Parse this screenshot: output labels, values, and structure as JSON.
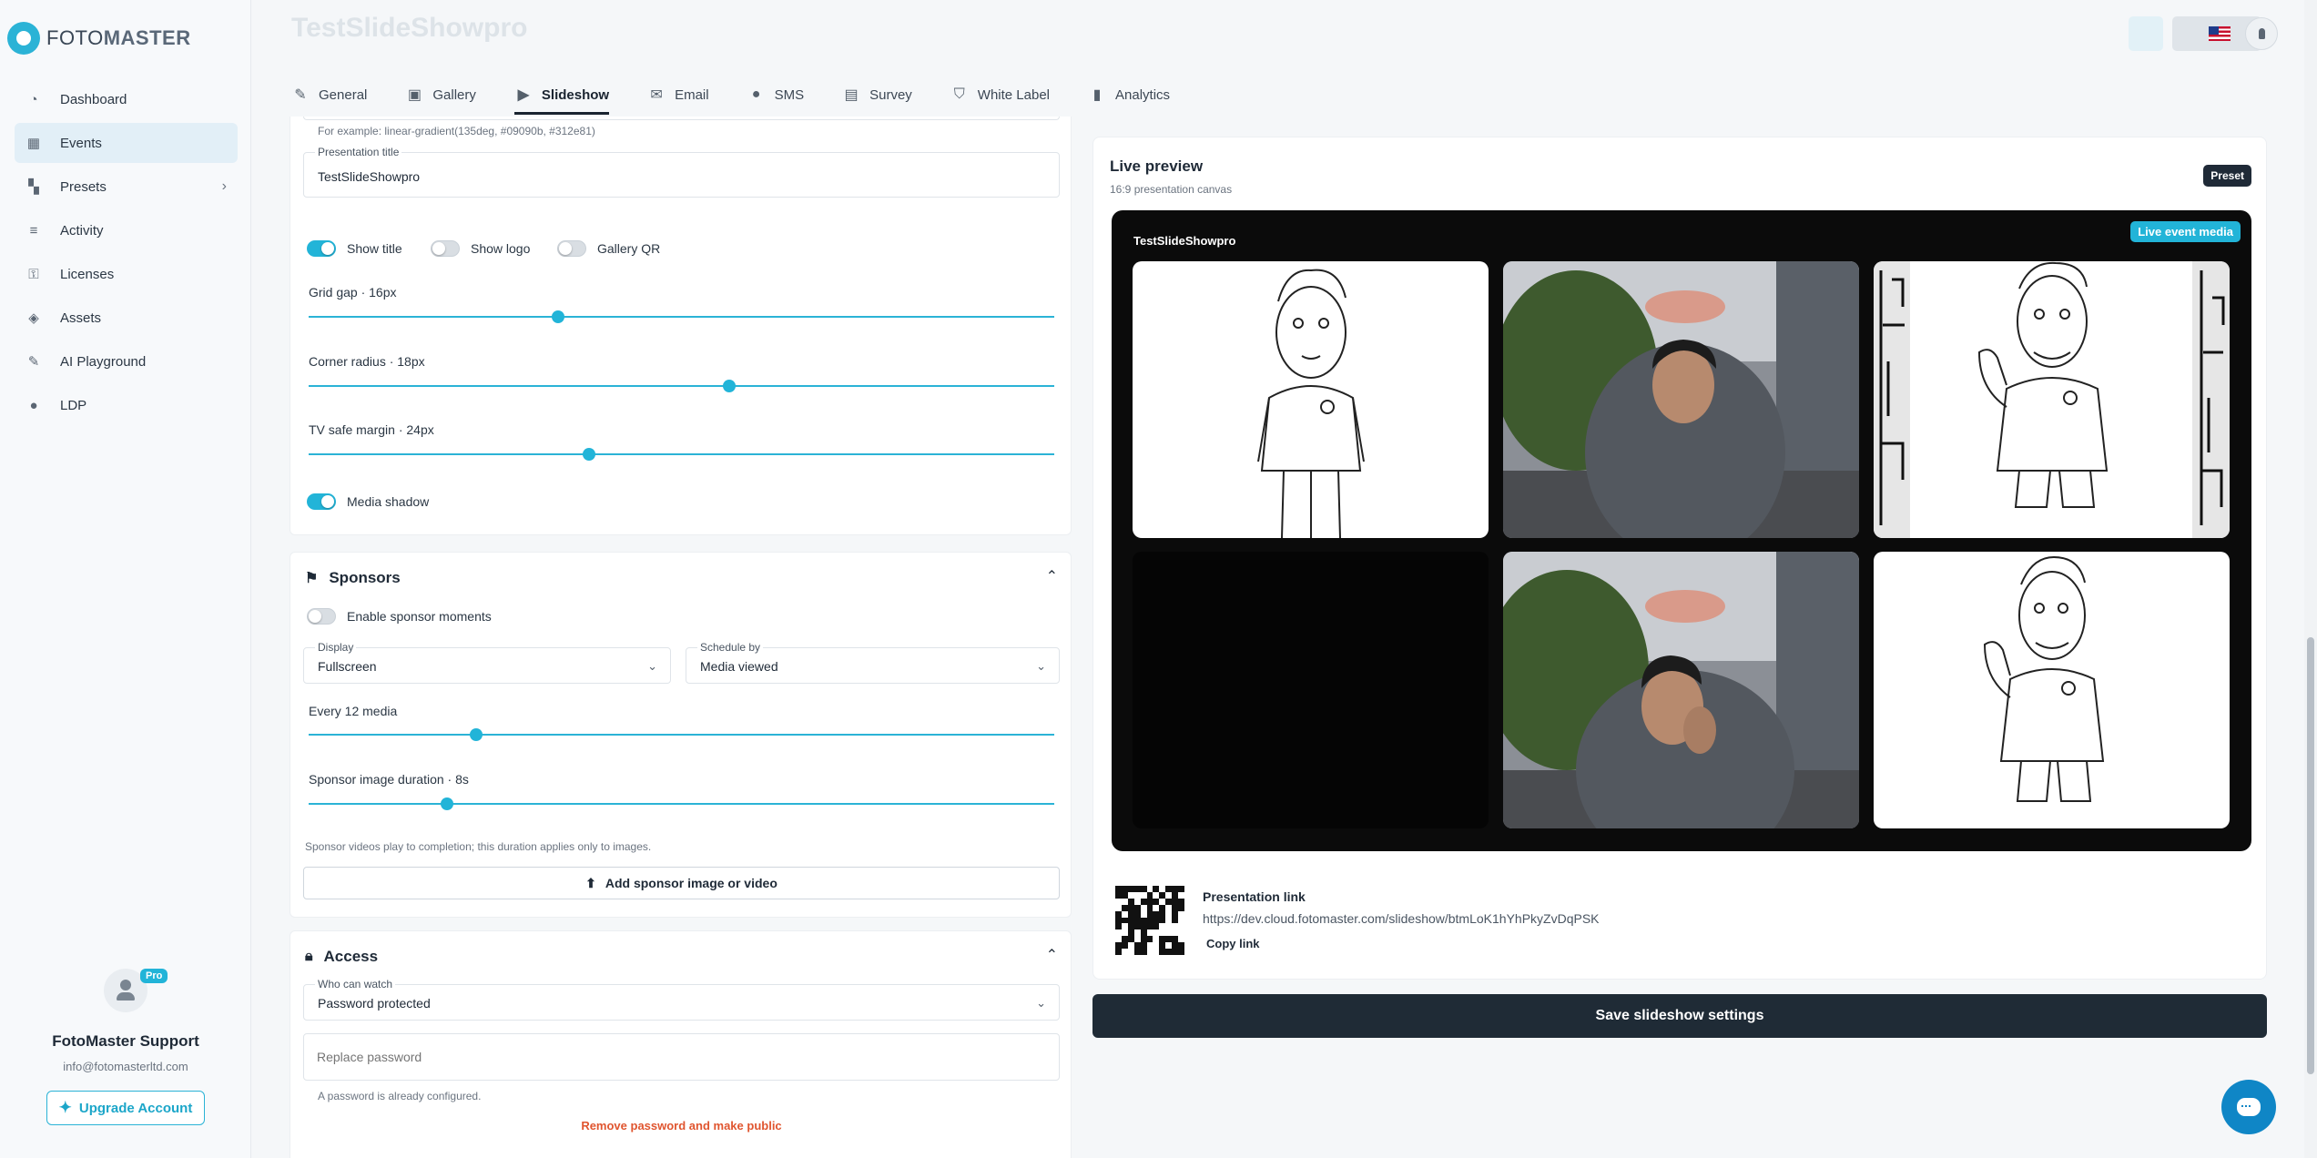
{
  "app": {
    "brand_prefix": "FOTO",
    "brand_suffix": "MASTER",
    "event_title": "TestSlideShowpro"
  },
  "sidebar": {
    "items": [
      {
        "label": "Dashboard",
        "icon": "gauge-icon"
      },
      {
        "label": "Events",
        "icon": "calendar-icon"
      },
      {
        "label": "Presets",
        "icon": "grid-icon"
      },
      {
        "label": "Activity",
        "icon": "activity-icon"
      },
      {
        "label": "Licenses",
        "icon": "key-icon"
      },
      {
        "label": "Assets",
        "icon": "bag-icon"
      },
      {
        "label": "AI Playground",
        "icon": "wand-icon"
      },
      {
        "label": "LDP",
        "icon": "pin-icon"
      }
    ],
    "active": "Events"
  },
  "profile": {
    "badge": "Pro",
    "name": "FotoMaster Support",
    "email": "info@fotomasterltd.com",
    "upgrade_label": "Upgrade Account"
  },
  "tabs": [
    {
      "label": "General",
      "icon": "pencil-icon"
    },
    {
      "label": "Gallery",
      "icon": "image-icon"
    },
    {
      "label": "Slideshow",
      "icon": "play-icon"
    },
    {
      "label": "Email",
      "icon": "mail-icon"
    },
    {
      "label": "SMS",
      "icon": "chat-icon"
    },
    {
      "label": "Survey",
      "icon": "clipboard-icon"
    },
    {
      "label": "White Label",
      "icon": "shield-icon"
    },
    {
      "label": "Analytics",
      "icon": "bar-chart-icon"
    }
  ],
  "active_tab": "Slideshow",
  "appearance": {
    "gradient_hint": "For example: linear-gradient(135deg, #09090b, #312e81)",
    "presentation_title_label": "Presentation title",
    "presentation_title_value": "TestSlideShowpro",
    "toggles": [
      {
        "label": "Show title",
        "on": true
      },
      {
        "label": "Show logo",
        "on": false
      },
      {
        "label": "Gallery QR",
        "on": false
      }
    ],
    "sliders": [
      {
        "label": "Grid gap · 16px",
        "value_fraction": 0.335
      },
      {
        "label": "Corner radius · 18px",
        "value_fraction": 0.564
      },
      {
        "label": "TV safe margin · 24px",
        "value_fraction": 0.376
      }
    ],
    "media_shadow_label": "Media shadow",
    "media_shadow_on": true
  },
  "sponsors": {
    "title": "Sponsors",
    "enable_label": "Enable sponsor moments",
    "enable_on": false,
    "display_label": "Display",
    "display_value": "Fullscreen",
    "schedule_label": "Schedule by",
    "schedule_value": "Media viewed",
    "every_label": "Every 12 media",
    "every_fraction": 0.225,
    "duration_label": "Sponsor image duration · 8s",
    "duration_fraction": 0.185,
    "note": "Sponsor videos play to completion; this duration applies only to images.",
    "add_label": "Add sponsor image or video"
  },
  "access": {
    "title": "Access",
    "who_label": "Who can watch",
    "who_value": "Password protected",
    "password_placeholder": "Replace password",
    "password_note": "A password is already configured.",
    "remove_label": "Remove password and make public"
  },
  "preview": {
    "title": "Live preview",
    "subtitle": "16:9 presentation canvas",
    "preset_label": "Preset",
    "canvas_title": "TestSlideShowpro",
    "live_badge": "Live event media",
    "link_title": "Presentation link",
    "link_url": "https://dev.cloud.fotomaster.com/slideshow/btmLoK1hYhPkyZvDqPSK",
    "copy_label": "Copy link"
  },
  "save_label": "Save slideshow settings",
  "colors": {
    "accent": "#22b4d8",
    "dark": "#1f2b36",
    "danger": "#e0552f"
  }
}
